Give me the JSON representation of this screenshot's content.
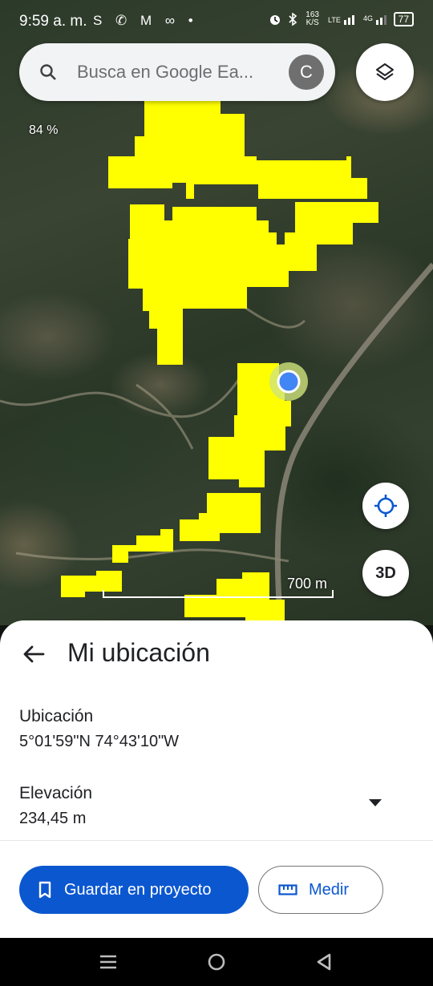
{
  "status_bar": {
    "time": "9:59 a. m.",
    "left_icons": "S ✆ M ∞ •",
    "network_speed": "163 K/S",
    "battery": "77"
  },
  "search": {
    "placeholder": "Busca en Google Ea...",
    "avatar_letter": "C"
  },
  "map": {
    "zoom_level": "84 %",
    "scale_label": "700 m",
    "button_3d": "3D",
    "overlay_color": "#ffff00",
    "location_dot_color": "#4285f4"
  },
  "sheet": {
    "title": "Mi ubicación",
    "location_label": "Ubicación",
    "location_value": "5°01'59\"N 74°43'10\"W",
    "elevation_label": "Elevación",
    "elevation_value": "234,45 m",
    "save_button": "Guardar en proyecto",
    "measure_button": "Medir",
    "accent_color": "#0b57d0"
  }
}
